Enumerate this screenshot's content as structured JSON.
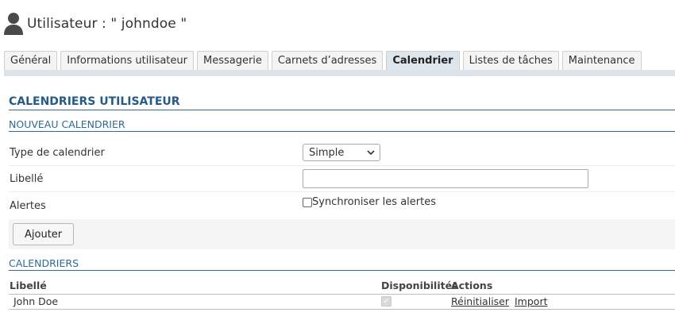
{
  "header": {
    "title": "Utilisateur : \" johndoe \"",
    "icon": "user-icon"
  },
  "tabs": [
    {
      "label": "Général"
    },
    {
      "label": "Informations utilisateur"
    },
    {
      "label": "Messagerie"
    },
    {
      "label": "Carnets d’adresses"
    },
    {
      "label": "Calendrier",
      "active": true
    },
    {
      "label": "Listes de tâches"
    },
    {
      "label": "Maintenance"
    }
  ],
  "section": {
    "title": "CALENDRIERS UTILISATEUR"
  },
  "new_calendar": {
    "title": "NOUVEAU CALENDRIER",
    "type_label": "Type de calendrier",
    "type_value": "Simple",
    "name_label": "Libellé",
    "name_value": "",
    "alerts_label": "Alertes",
    "sync_label": "Synchroniser les alertes",
    "add_button": "Ajouter"
  },
  "calendars": {
    "title": "CALENDRIERS",
    "columns": [
      "Libellé",
      "Disponibilités",
      "Actions"
    ],
    "rows": [
      {
        "name": "John Doe",
        "availability": true,
        "actions": [
          "Réinitialiser",
          "Import"
        ]
      }
    ]
  },
  "colors": {
    "accent": "#2d6a96",
    "tab_active": "#dde6ec",
    "tab_bar": "#dbe3e9"
  }
}
